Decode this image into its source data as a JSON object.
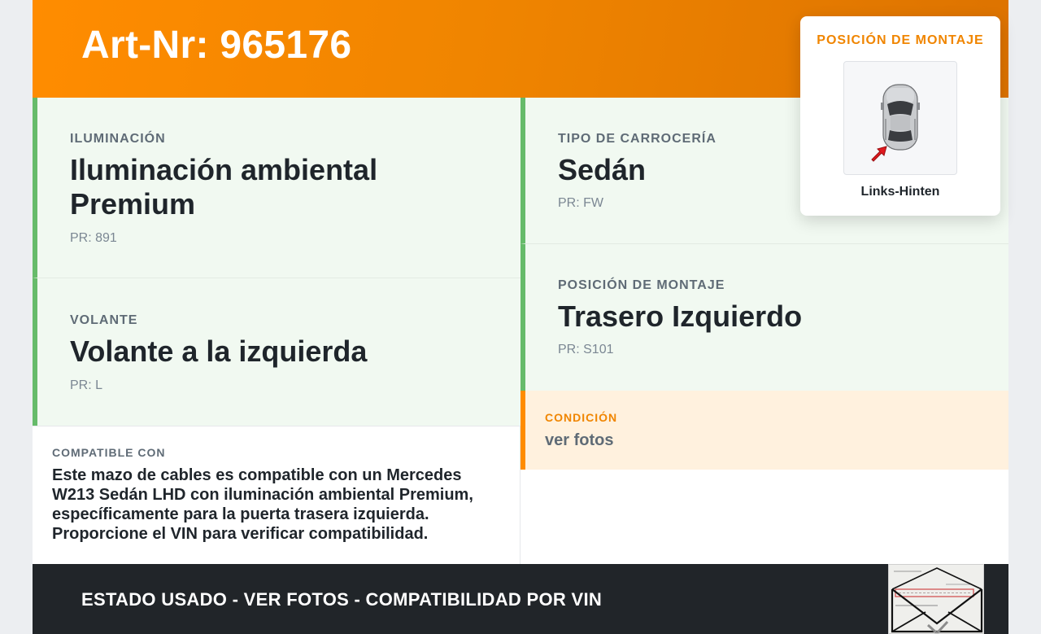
{
  "header": {
    "title": "Art-Nr: 965176"
  },
  "specs": {
    "lighting": {
      "label": "ILUMINACIÓN",
      "value": "Iluminación ambiental Premium",
      "pr": "PR: 891"
    },
    "body": {
      "label": "TIPO DE CARROCERÍA",
      "value": "Sedán",
      "pr": "PR: FW"
    },
    "steering": {
      "label": "VOLANTE",
      "value": "Volante a la izquierda",
      "pr": "PR: L"
    },
    "mount": {
      "label": "POSICIÓN DE MONTAJE",
      "value": "Trasero Izquierdo",
      "pr": "PR: S101"
    }
  },
  "compatible": {
    "label": "COMPATIBLE CON",
    "text": "Este mazo de cables es compatible con un Mercedes W213 Sedán LHD con iluminación ambiental Premium, específicamente para la puerta trasera izquierda. Proporcione el VIN para verificar compatibilidad."
  },
  "condition": {
    "label": "CONDICIÓN",
    "value": "ver fotos"
  },
  "popup": {
    "title": "POSICIÓN DE MONTAJE",
    "caption": "Links-Hinten",
    "icon": "car-top-view-icon"
  },
  "footer": {
    "text": "ESTADO USADO - VER FOTOS - COMPATIBILIDAD POR VIN"
  },
  "colors": {
    "accent": "#ff8c00",
    "green": "#66bb6a",
    "dark": "#212529"
  }
}
